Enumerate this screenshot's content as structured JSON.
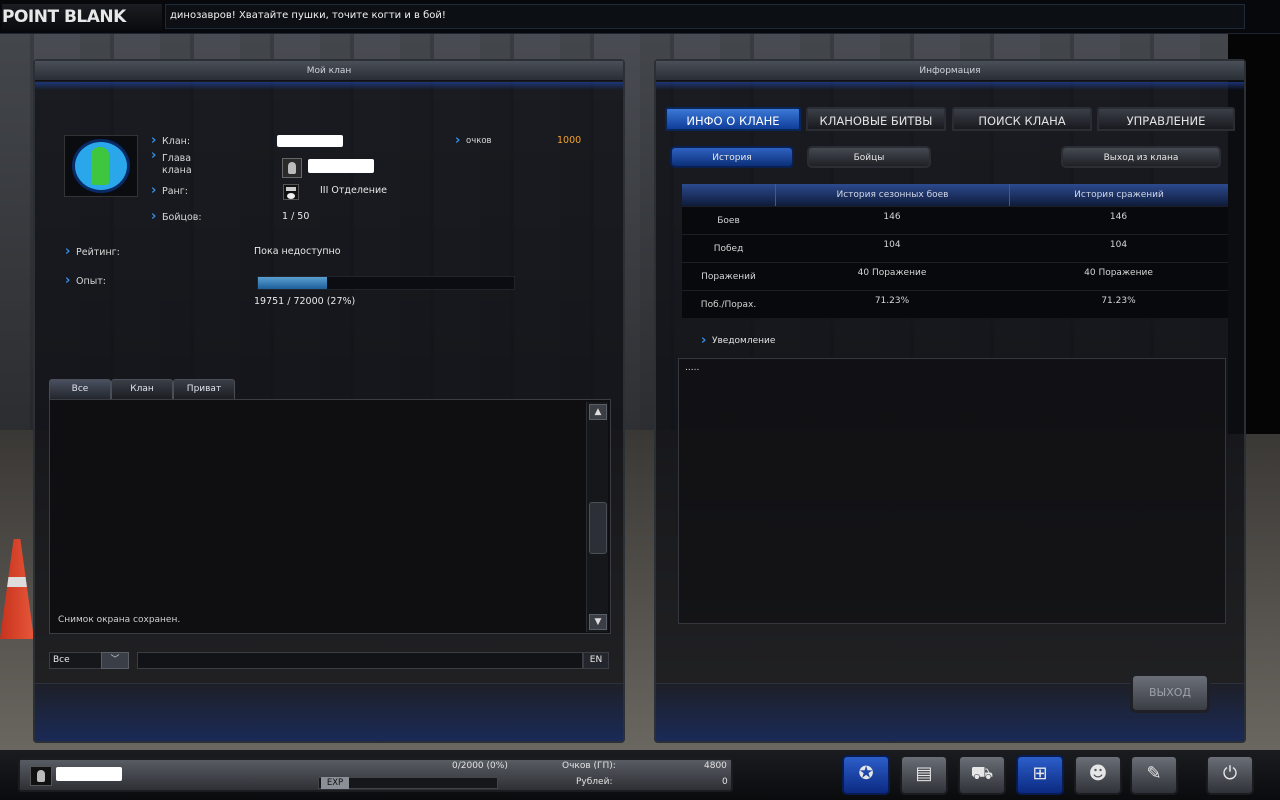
{
  "topbar": {
    "logo": "POINT BLANK",
    "ticker": "динозавров! Хватайте пушки, точите когти и в бой!"
  },
  "left_panel": {
    "title": "Мой клан",
    "labels": {
      "clan": "Клан:",
      "leader": "Глава клана",
      "rank": "Ранг:",
      "fighters": "Бойцов:",
      "points": "очков",
      "rating": "Рейтинг:",
      "experience": "Опыт:"
    },
    "values": {
      "points": "1000",
      "rank": "III Отделение",
      "fighters": "1 / 50",
      "rating": "Пока недоступно",
      "experience": "19751 / 72000 (27%)",
      "experience_fraction": 0.27
    },
    "chat": {
      "tabs": [
        "Все",
        "Клан",
        "Приват"
      ],
      "message": "Снимок окрана сохранен.",
      "channel": "Все",
      "lang": "EN"
    }
  },
  "right_panel": {
    "title": "Информация",
    "tabs": [
      "ИНФО О КЛАНЕ",
      "КЛАНОВЫЕ БИТВЫ",
      "ПОИСК КЛАНА",
      "УПРАВЛЕНИЕ"
    ],
    "subbuttons": [
      "История",
      "Бойцы",
      "Выход из клана"
    ],
    "table": {
      "headers": [
        "История сезонных боев",
        "История сражений"
      ],
      "rows": [
        {
          "label": "Боев",
          "season": "146",
          "total": "146"
        },
        {
          "label": "Побед",
          "season": "104",
          "total": "104"
        },
        {
          "label": "Поражений",
          "season": "40 Поражение",
          "total": "40 Поражение"
        },
        {
          "label": "Поб./Порах.",
          "season": "71.23%",
          "total": "71.23%"
        }
      ]
    },
    "notice_title": "Уведомление",
    "notice_text": ".....",
    "exit_button": "ВЫХОД"
  },
  "bottom_bar": {
    "exp_label": "EXP",
    "exp_progress": "0/2000 (0%)",
    "points_label": "Очков (ГП):",
    "points_value": "4800",
    "rubles_label": "Рублей:",
    "rubles_value": "0",
    "menu_icons": [
      "clan-emblem-icon",
      "inventory-icon",
      "shop-bag-icon",
      "cart-icon",
      "community-icon",
      "settings-wrench-icon",
      "power-icon"
    ]
  }
}
